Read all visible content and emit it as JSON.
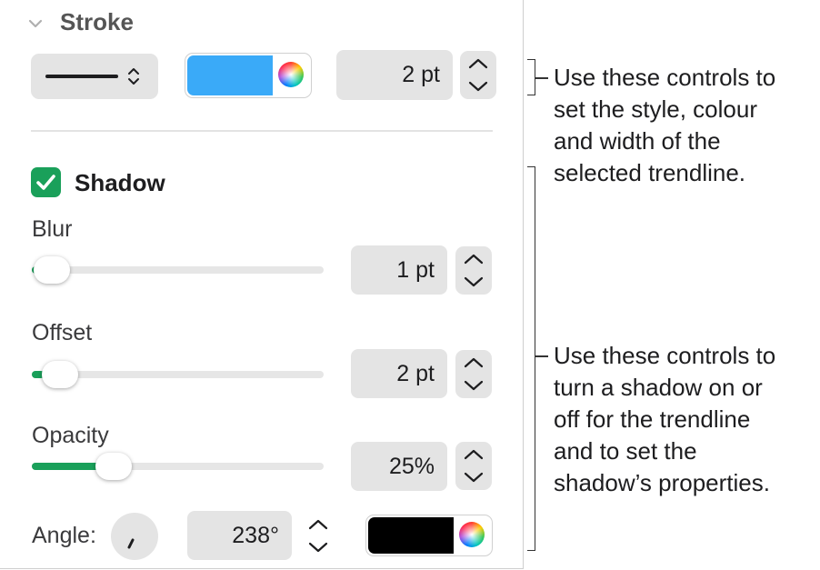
{
  "stroke": {
    "title": "Stroke",
    "width_value": "2 pt",
    "color": "#3aaaf8"
  },
  "shadow": {
    "title": "Shadow",
    "checked": true,
    "blur": {
      "label": "Blur",
      "value": "1 pt",
      "level": 0.02
    },
    "offset": {
      "label": "Offset",
      "value": "2 pt",
      "level": 0.04
    },
    "opacity": {
      "label": "Opacity",
      "value": "25%",
      "level": 0.25
    },
    "angle": {
      "label": "Angle:",
      "value": "238°"
    },
    "color": "#000000"
  },
  "callouts": {
    "stroke_lines": [
      "Use these controls to",
      "set the style, colour",
      "and width of the",
      "selected trendline."
    ],
    "shadow_lines": [
      "Use these controls to",
      "turn a shadow on or",
      "off for the trendline",
      "and to set the",
      "shadow’s properties."
    ]
  },
  "colors": {
    "accent_green": "#1aa05a",
    "checkbox_green": "#1aa05a"
  },
  "icons": [
    "chevron-down-icon",
    "line-style-icon",
    "up-down-chevron-icon",
    "color-wheel-icon",
    "checkmark-icon",
    "stepper-icon",
    "angle-dial-icon"
  ]
}
